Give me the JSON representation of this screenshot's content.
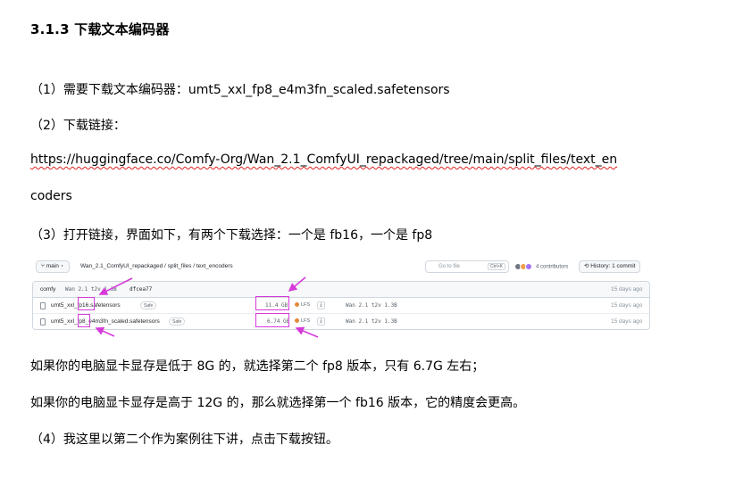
{
  "heading": "3.1.3 下载文本编码器",
  "lines": {
    "l1": "（1）需要下载文本编码器：umt5_xxl_fp8_e4m3fn_scaled.safetensors",
    "l2": "（2）下载链接：",
    "l3": "https://huggingface.co/Comfy-Org/Wan_2.1_ComfyUI_repackaged/tree/main/split_files/text_en",
    "l4": "coders",
    "l5": "（3）打开链接，界面如下，有两个下载选择：一个是 fb16，一个是 fp8",
    "l6": "如果你的电脑显卡显存是低于 8G 的，就选择第二个 fp8 版本，只有 6.7G 左右；",
    "l7": "如果你的电脑显卡显存是高于 12G 的，那么就选择第一个 fb16 版本，它的精度会更高。",
    "l8": "（4）我这里以第二个作为案例往下讲，点击下载按钮。"
  },
  "screenshot": {
    "branch": "main",
    "path": "Wan_2.1_ComfyUI_repackaged / split_files / text_encoders",
    "goto_placeholder": "Go to file",
    "goto_kbd": "Ctrl+K",
    "contributors": "4 contributors",
    "history": "History: 1 commit",
    "header_row": {
      "user": "comfy",
      "msg": "Wan 2.1 t2v 1.3B",
      "hash": "dfcea77",
      "age": "15 days ago"
    },
    "files": [
      {
        "name": "umt5_xxl_fp16.safetensors",
        "safe": "Safe",
        "size": "11.4 GB",
        "lfs": "LFS",
        "msg": "Wan 2.1 t2v 1.3B",
        "age": "15 days ago"
      },
      {
        "name": "umt5_xxl_fp8_e4m3fn_scaled.safetensors",
        "safe": "Safe",
        "size": "6.74 GB",
        "lfs": "LFS",
        "msg": "Wan 2.1 t2v 1.3B",
        "age": "15 days ago"
      }
    ],
    "annotation_color": "#d63ad9"
  }
}
